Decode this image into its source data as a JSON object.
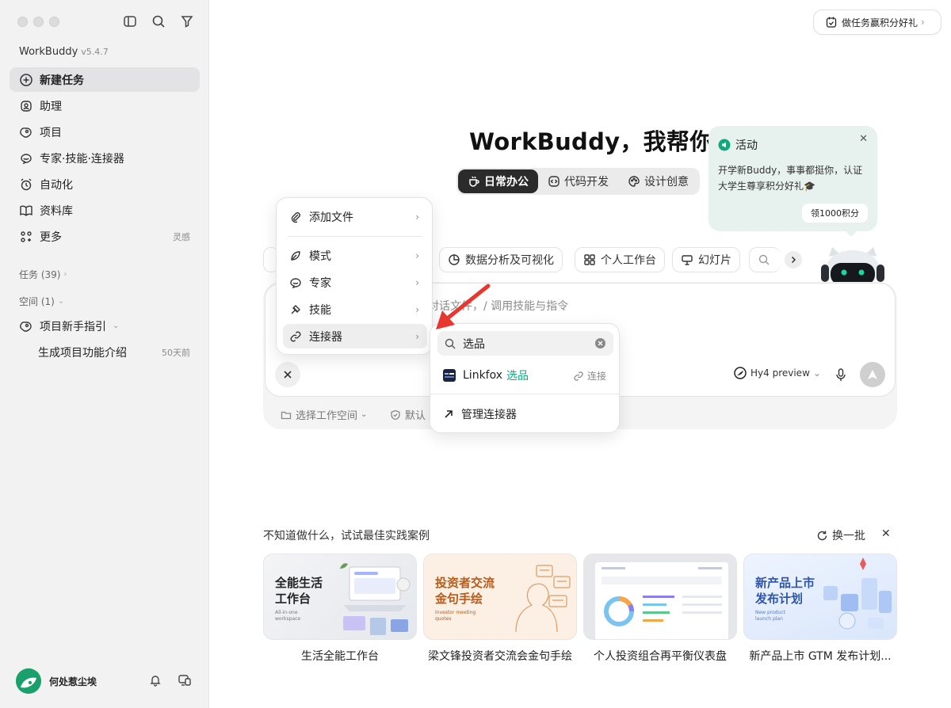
{
  "sidebar": {
    "app_name": "WorkBuddy",
    "version": "v5.4.7",
    "nav": [
      {
        "label": "新建任务",
        "icon": "plus-circle-icon",
        "right": ""
      },
      {
        "label": "助理",
        "icon": "assistant-icon",
        "right": ""
      },
      {
        "label": "项目",
        "icon": "project-icon",
        "right": ""
      },
      {
        "label": "专家·技能·连接器",
        "icon": "expert-icon",
        "right": ""
      },
      {
        "label": "自动化",
        "icon": "alarm-clock-icon",
        "right": ""
      },
      {
        "label": "资料库",
        "icon": "book-icon",
        "right": ""
      },
      {
        "label": "更多",
        "icon": "grid-more-icon",
        "right": "灵感"
      }
    ],
    "tasks_label": "任务 (39)",
    "space_label": "空间 (1)",
    "project_guide": "项目新手指引",
    "project_sub": "生成项目功能介绍",
    "project_sub_time": "50天前",
    "username": "何处惹尘埃"
  },
  "header": {
    "task_pill": "做任务赢积分好礼"
  },
  "hero": {
    "title": "WorkBuddy，我帮你",
    "modes": [
      {
        "label": "日常办公",
        "icon": "coffee-icon"
      },
      {
        "label": "代码开发",
        "icon": "code-icon"
      },
      {
        "label": "设计创意",
        "icon": "palette-icon"
      }
    ]
  },
  "activity": {
    "title": "活动",
    "body": "开学新Buddy，事事都挺你，认证大学生尊享积分好礼🎓",
    "button": "领1000积分"
  },
  "chips": [
    {
      "label": "数据分析及可视化",
      "icon": "pie-chart-icon"
    },
    {
      "label": "个人工作台",
      "icon": "grid-icon"
    },
    {
      "label": "幻灯片",
      "icon": "presentation-icon"
    }
  ],
  "input": {
    "placeholder": "对话文件，/ 调用技能与指令",
    "model": "Hy4 preview",
    "footer_workspace": "选择工作空间",
    "footer_default": "默认"
  },
  "menu": {
    "items": [
      {
        "label": "添加文件",
        "icon": "paperclip-icon"
      },
      {
        "label": "模式",
        "icon": "leaf-icon"
      },
      {
        "label": "专家",
        "icon": "expert-icon"
      },
      {
        "label": "技能",
        "icon": "skill-icon"
      },
      {
        "label": "连接器",
        "icon": "link-icon"
      }
    ]
  },
  "submenu": {
    "search_value": "选品",
    "result_name": "Linkfox",
    "result_match": "选品",
    "connect_label": "连接",
    "manage_label": "管理连接器"
  },
  "examples": {
    "title": "不知道做什么，试试最佳实践案例",
    "refresh": "换一批",
    "cards": [
      {
        "caption": "生活全能工作台",
        "heading1": "全能生活",
        "heading2": "工作台",
        "sub": "All-in-one workspace"
      },
      {
        "caption": "梁文锋投资者交流会金句手绘",
        "heading1": "投资者交流",
        "heading2": "金句手绘",
        "sub": "Investor meeting quotes"
      },
      {
        "caption": "个人投资组合再平衡仪表盘",
        "heading1": "",
        "heading2": "",
        "sub": ""
      },
      {
        "caption": "新产品上市 GTM 发布计划...",
        "heading1": "新产品上市",
        "heading2": "发布计划",
        "sub": "New product launch plan"
      }
    ]
  },
  "colors": {
    "accent_green": "#14a77d",
    "active_mode": "#2b2b2b",
    "activity_bg": "#e7f2ef",
    "arrow_red": "#e8372f"
  }
}
